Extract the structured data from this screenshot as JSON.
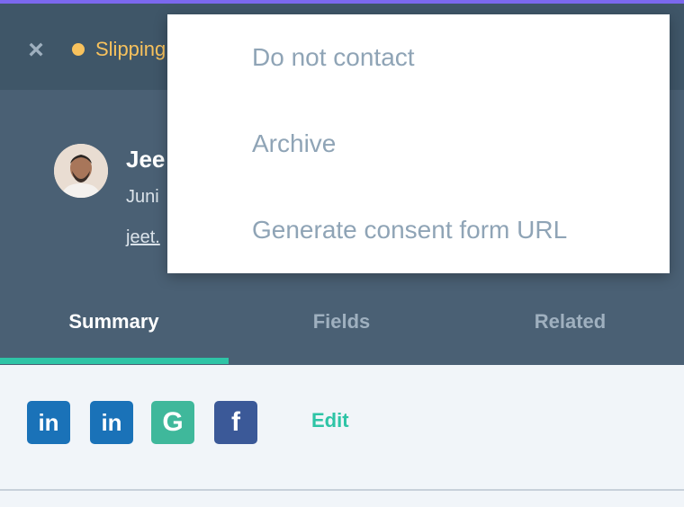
{
  "header": {
    "close_icon": "close-icon",
    "status_label": "Slipping"
  },
  "profile": {
    "name": "Jee",
    "role": "Juni",
    "email": "jeet."
  },
  "tabs": [
    {
      "label": "Summary",
      "active": true
    },
    {
      "label": "Fields",
      "active": false
    },
    {
      "label": "Related",
      "active": false
    }
  ],
  "social": {
    "items": [
      {
        "name": "linkedin-icon",
        "glyph": "in",
        "color": "#1a72b8"
      },
      {
        "name": "linkedin-icon",
        "glyph": "in",
        "color": "#1a72b8"
      },
      {
        "name": "google-icon",
        "glyph": "G",
        "color": "#3fb89b"
      },
      {
        "name": "facebook-icon",
        "glyph": "f",
        "color": "#3b5998"
      }
    ],
    "edit_label": "Edit"
  },
  "menu": {
    "items": [
      {
        "label": "Do not contact"
      },
      {
        "label": "Archive"
      },
      {
        "label": "Generate consent form URL"
      }
    ]
  },
  "colors": {
    "accent": "#7b68ee",
    "status": "#f8c25d",
    "teal": "#2ec4a6"
  }
}
